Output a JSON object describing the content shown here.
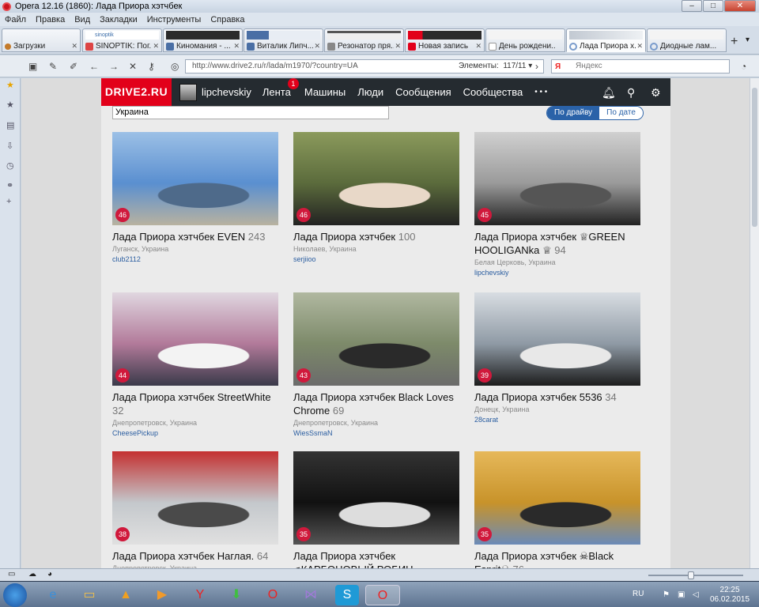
{
  "window": {
    "title": "Opera 12.16 (1860): Лада Приора хэтчбек",
    "minimize": "–",
    "maximize": "□",
    "close": "✕"
  },
  "menu": [
    "Файл",
    "Правка",
    "Вид",
    "Закладки",
    "Инструменты",
    "Справка"
  ],
  "tabs": [
    {
      "label": "Загрузки",
      "thumb": "",
      "icon": "download-icon",
      "fav_color": "#c47a2a"
    },
    {
      "label": "SINOPTIK: Пог...",
      "thumb": "sinoptik",
      "icon": "sinoptik-icon",
      "fav_color": "#d44"
    },
    {
      "label": "Киномания - ...",
      "thumb": "",
      "icon": "vk-icon",
      "fav_color": "#4a6fa5"
    },
    {
      "label": "Виталик Липч...",
      "thumb": "",
      "icon": "vk-icon",
      "fav_color": "#4a6fa5"
    },
    {
      "label": "Резонатор пря...",
      "thumb": "",
      "icon": "page-icon",
      "fav_color": "#888"
    },
    {
      "label": "Новая запись",
      "thumb": "",
      "icon": "drive2-icon",
      "fav_color": "#e2001a"
    },
    {
      "label": "День рождени...",
      "thumb": "",
      "icon": "page-icon",
      "fav_color": "#bbb"
    },
    {
      "label": "Лада Приора х...",
      "thumb": "",
      "icon": "loading-icon",
      "fav_color": "#7a9ccc"
    },
    {
      "label": "Диодные лам...",
      "thumb": "",
      "icon": "loading-icon",
      "fav_color": "#7a9ccc"
    }
  ],
  "address": {
    "url": "http://www.drive2.ru/r/lada/m1970/?country=UA",
    "elements_label": "Элементы:",
    "elements_value": "117/11",
    "search_placeholder": "Яндекс",
    "search_engine": "Я"
  },
  "site": {
    "logo": "DRIVE2.RU",
    "username": "lipchevskiy",
    "nav": [
      "Лента",
      "Машины",
      "Люди",
      "Сообщения",
      "Сообщества"
    ],
    "more": "• • •",
    "feed_badge": "1",
    "country": "Украина",
    "sort_by_drive": "По драйву",
    "sort_by_date": "По дате"
  },
  "cards": [
    {
      "title": "Лада Приора хэтчбек EVEN",
      "count": "243",
      "location": "Луганск, Украина",
      "user": "club2112",
      "score": "46",
      "palette": [
        "#5a8fd0",
        "#9cc0e6",
        "#4e6a8a",
        "#b8b2a0"
      ]
    },
    {
      "title": "Лада Приора хэтчбек",
      "count": "100",
      "location": "Николаев, Украина",
      "user": "serjiioo",
      "score": "46",
      "palette": [
        "#5b6b3c",
        "#8b9a5c",
        "#e8d8c8",
        "#222"
      ]
    },
    {
      "title": "Лада Приора хэтчбек ♕GREEN HOOLIGANka ♕",
      "count": "94",
      "location": "Белая Церковь, Украина",
      "user": "lipchevskiy",
      "score": "45",
      "palette": [
        "#9a9a9a",
        "#d0d0d0",
        "#555",
        "#222"
      ]
    },
    {
      "title": "Лада Приора хэтчбек StreetWhite",
      "count": "32",
      "location": "Днепропетровск, Украина",
      "user": "CheesePickup",
      "score": "44",
      "palette": [
        "#b27a9a",
        "#e0d7e0",
        "#f3f3f3",
        "#3a3a4a"
      ]
    },
    {
      "title": "Лада Приора хэтчбек Black Loves Chrome",
      "count": "69",
      "location": "Днепропетровск, Украина",
      "user": "WiesSsmaN",
      "score": "43",
      "palette": [
        "#7d8a6a",
        "#b0b8a0",
        "#2a2a2a",
        "#6b6b6b"
      ]
    },
    {
      "title": "Лада Приора хэтчбек 5536",
      "count": "34",
      "location": "Донецк, Украина",
      "user": "28carat",
      "score": "39",
      "palette": [
        "#8f9aa5",
        "#d8dde2",
        "#e8e8e8",
        "#1c1c1c"
      ]
    },
    {
      "title": "Лада Приора хэтчбек Наглая.",
      "count": "64",
      "location": "Днепропетровск, Украина",
      "user": "",
      "score": "38",
      "palette": [
        "#c4c8cc",
        "#c43030",
        "#4a4a4a",
        "#e0e0e0"
      ]
    },
    {
      "title": "Лада Приора хэтчбек ♫КАРБОНОВЫЙ РОБИН",
      "count": "",
      "location": "",
      "user": "",
      "score": "35",
      "palette": [
        "#111",
        "#333",
        "#ddd",
        "#555"
      ]
    },
    {
      "title": "Лада Приора хэтчбек ☠Black Esprit☠",
      "count": "76",
      "location": "",
      "user": "",
      "score": "35",
      "palette": [
        "#c8932a",
        "#e6b85a",
        "#2a2a2a",
        "#6a8ab8"
      ]
    }
  ],
  "taskbar": {
    "lang": "RU",
    "time": "22:25",
    "date": "06.02.2015"
  }
}
